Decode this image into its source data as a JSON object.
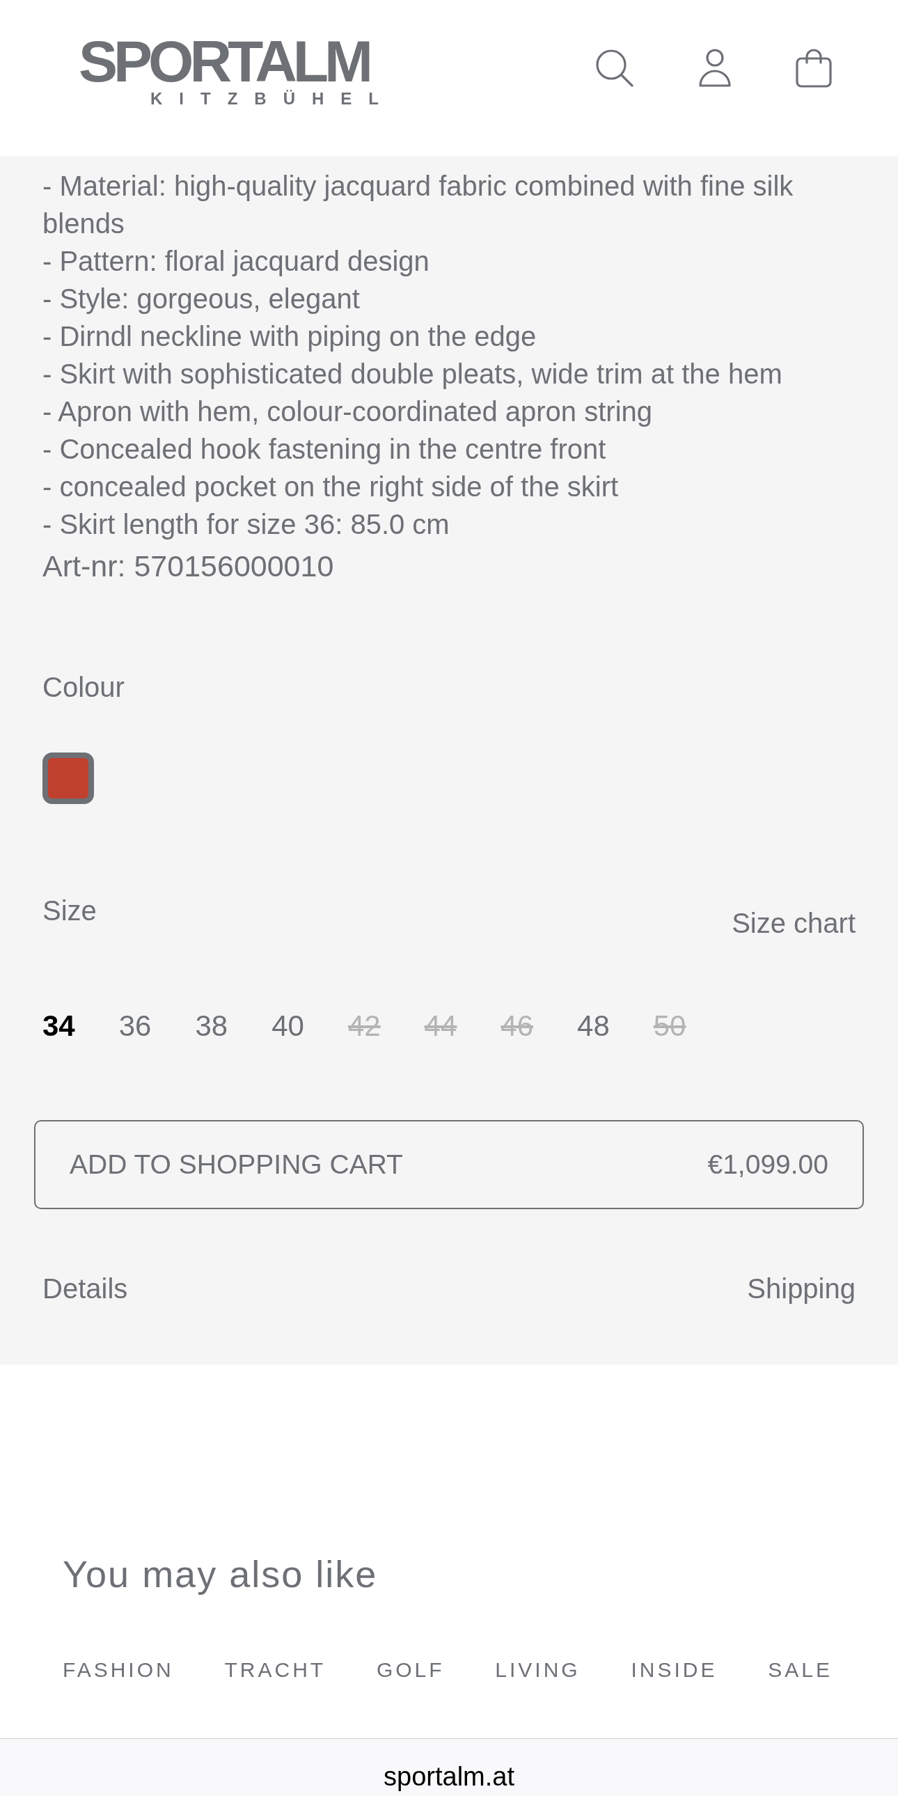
{
  "header": {
    "logo": {
      "wordmark": "SPORTALM",
      "tagline": "KITZBÜHEL"
    }
  },
  "description": {
    "lines": [
      "- Material: high-quality jacquard fabric combined with fine silk blends",
      "- Pattern: floral jacquard design",
      "- Style: gorgeous, elegant",
      "- Dirndl neckline with piping on the edge",
      "- Skirt with sophisticated double pleats, wide trim at the hem",
      "- Apron with hem, colour-coordinated apron string",
      "- Concealed hook fastening in the centre front",
      "- concealed pocket on the right side of the skirt",
      "- Skirt length for size 36: 85.0 cm"
    ],
    "article_number": "Art-nr: 570156000010"
  },
  "colour": {
    "label": "Colour",
    "swatches": [
      {
        "color": "#c0402e",
        "selected": true
      }
    ]
  },
  "size": {
    "label": "Size",
    "size_chart": "Size chart",
    "options": [
      {
        "label": "34",
        "selected": true,
        "disabled": false
      },
      {
        "label": "36",
        "selected": false,
        "disabled": false
      },
      {
        "label": "38",
        "selected": false,
        "disabled": false
      },
      {
        "label": "40",
        "selected": false,
        "disabled": false
      },
      {
        "label": "42",
        "selected": false,
        "disabled": true
      },
      {
        "label": "44",
        "selected": false,
        "disabled": true
      },
      {
        "label": "46",
        "selected": false,
        "disabled": true
      },
      {
        "label": "48",
        "selected": false,
        "disabled": false
      },
      {
        "label": "50",
        "selected": false,
        "disabled": true
      }
    ]
  },
  "add_to_cart": {
    "label": "ADD TO SHOPPING CART",
    "price": "€1,099.00"
  },
  "info_links": [
    "Details",
    "Shipping"
  ],
  "recommendations": {
    "title": "You may also like"
  },
  "footer_nav": [
    "FASHION",
    "TRACHT",
    "GOLF",
    "LIVING",
    "INSIDE",
    "SALE"
  ],
  "browser": {
    "url": "sportalm.at"
  }
}
